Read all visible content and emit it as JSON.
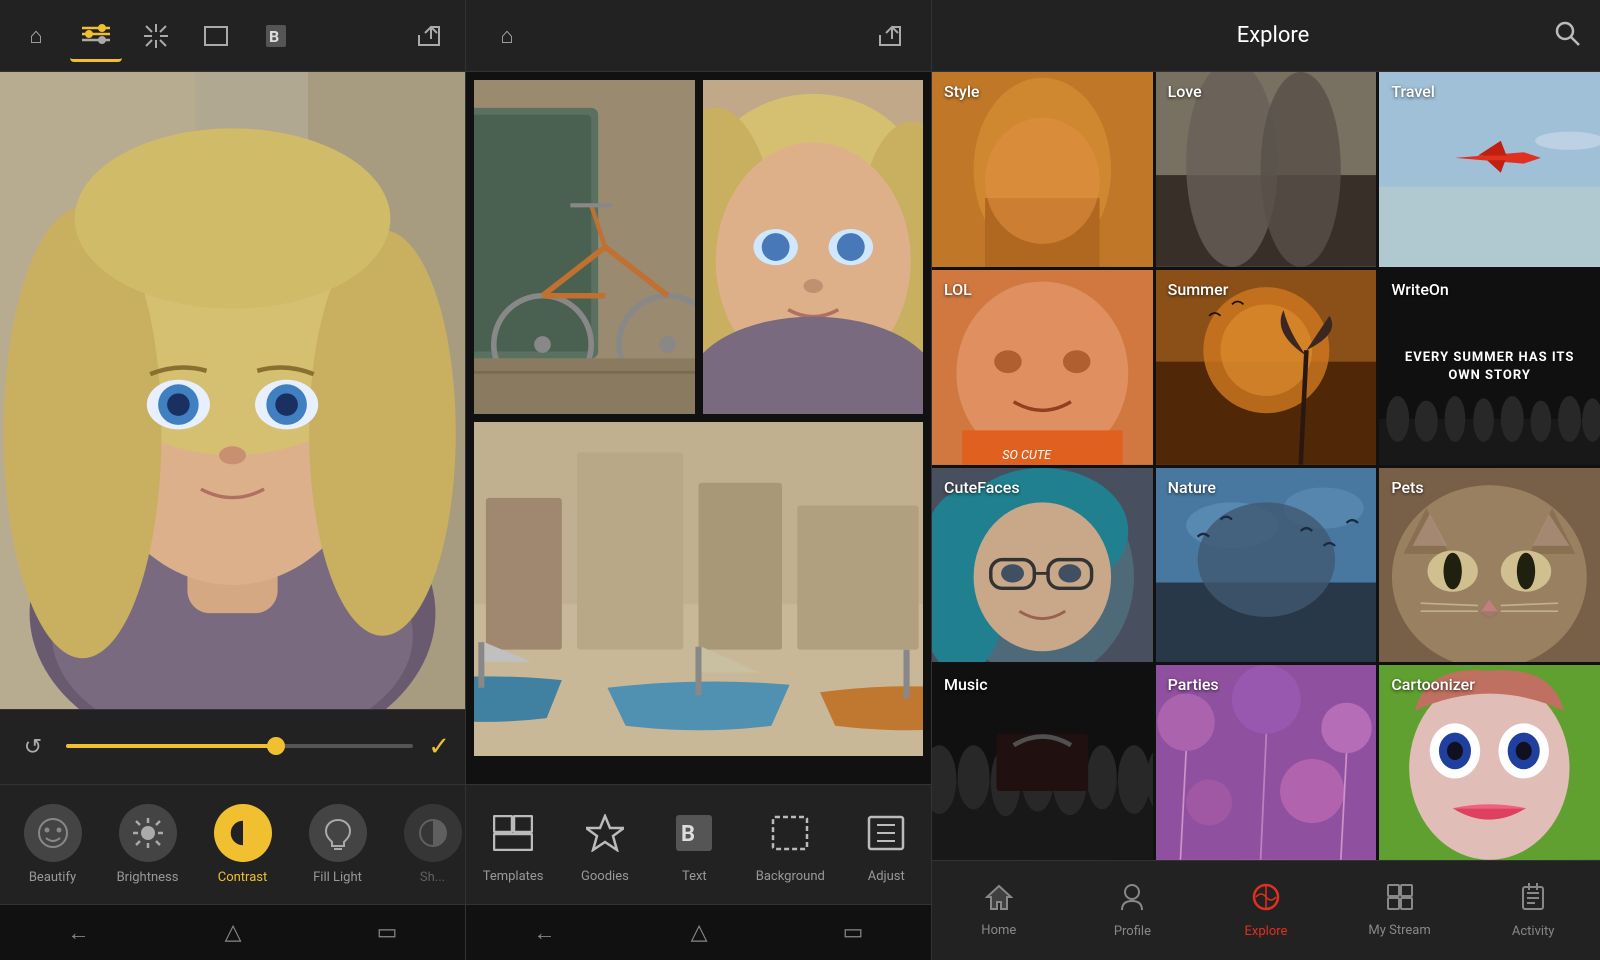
{
  "panel1": {
    "toolbar": {
      "home_label": "⌂",
      "adjust_label": "⚙",
      "magic_label": "✦",
      "frame_label": "▭",
      "bold_label": "B",
      "share_label": "↗"
    },
    "adjustment": {
      "undo_label": "↺",
      "check_label": "✓",
      "slider_fill_pct": 60
    },
    "tools": [
      {
        "id": "beautify",
        "label": "Beautify",
        "icon": "☺",
        "active": false
      },
      {
        "id": "brightness",
        "label": "Brightness",
        "icon": "☀",
        "active": false
      },
      {
        "id": "contrast",
        "label": "Contrast",
        "icon": "contrast",
        "active": true
      },
      {
        "id": "filllight",
        "label": "Fill Light",
        "icon": "💡",
        "active": false
      },
      {
        "id": "shadow",
        "label": "Shadow",
        "icon": "◑",
        "active": false
      }
    ],
    "nav": [
      "←",
      "△",
      "▭"
    ]
  },
  "panel2": {
    "toolbar": {
      "home_label": "⌂",
      "share_label": "↗"
    },
    "tools": [
      {
        "id": "templates",
        "label": "Templates",
        "icon": "⊞"
      },
      {
        "id": "goodies",
        "label": "Goodies",
        "icon": "◈"
      },
      {
        "id": "text",
        "label": "Text",
        "icon": "B"
      },
      {
        "id": "background",
        "label": "Background",
        "icon": "▢"
      },
      {
        "id": "adjust",
        "label": "Adjust",
        "icon": "⊡"
      }
    ],
    "nav": [
      "←",
      "△",
      "▭"
    ]
  },
  "panel3": {
    "header": {
      "title": "Explore",
      "search_icon": "🔍"
    },
    "grid": [
      {
        "id": "style",
        "label": "Style",
        "bg_class": "bg-style"
      },
      {
        "id": "love",
        "label": "Love",
        "bg_class": "bg-love"
      },
      {
        "id": "travel",
        "label": "Travel",
        "bg_class": "bg-travel"
      },
      {
        "id": "lol",
        "label": "LOL",
        "bg_class": "bg-lol"
      },
      {
        "id": "summer",
        "label": "Summer",
        "bg_class": "bg-summer"
      },
      {
        "id": "writeon",
        "label": "WriteOn",
        "bg_class": "bg-writeon",
        "subtext": "EVERY SUMMER HAS ITS OWN STORY"
      },
      {
        "id": "cutefaces",
        "label": "CuteFaces",
        "bg_class": "bg-cutefaces"
      },
      {
        "id": "nature",
        "label": "Nature",
        "bg_class": "bg-nature"
      },
      {
        "id": "pets",
        "label": "Pets",
        "bg_class": "bg-pets"
      },
      {
        "id": "music",
        "label": "Music",
        "bg_class": "bg-music"
      },
      {
        "id": "parties",
        "label": "Parties",
        "bg_class": "bg-parties"
      },
      {
        "id": "cartoonizer",
        "label": "Cartoonizer",
        "bg_class": "bg-cartoonizer"
      }
    ],
    "nav": [
      {
        "id": "home",
        "label": "Home",
        "icon": "⌂",
        "active": false
      },
      {
        "id": "profile",
        "label": "Profile",
        "icon": "👤",
        "active": false
      },
      {
        "id": "explore",
        "label": "Explore",
        "icon": "🌐",
        "active": true
      },
      {
        "id": "mystream",
        "label": "My Stream",
        "icon": "⊞",
        "active": false
      },
      {
        "id": "activity",
        "label": "Activity",
        "icon": "≡",
        "active": false
      }
    ]
  }
}
